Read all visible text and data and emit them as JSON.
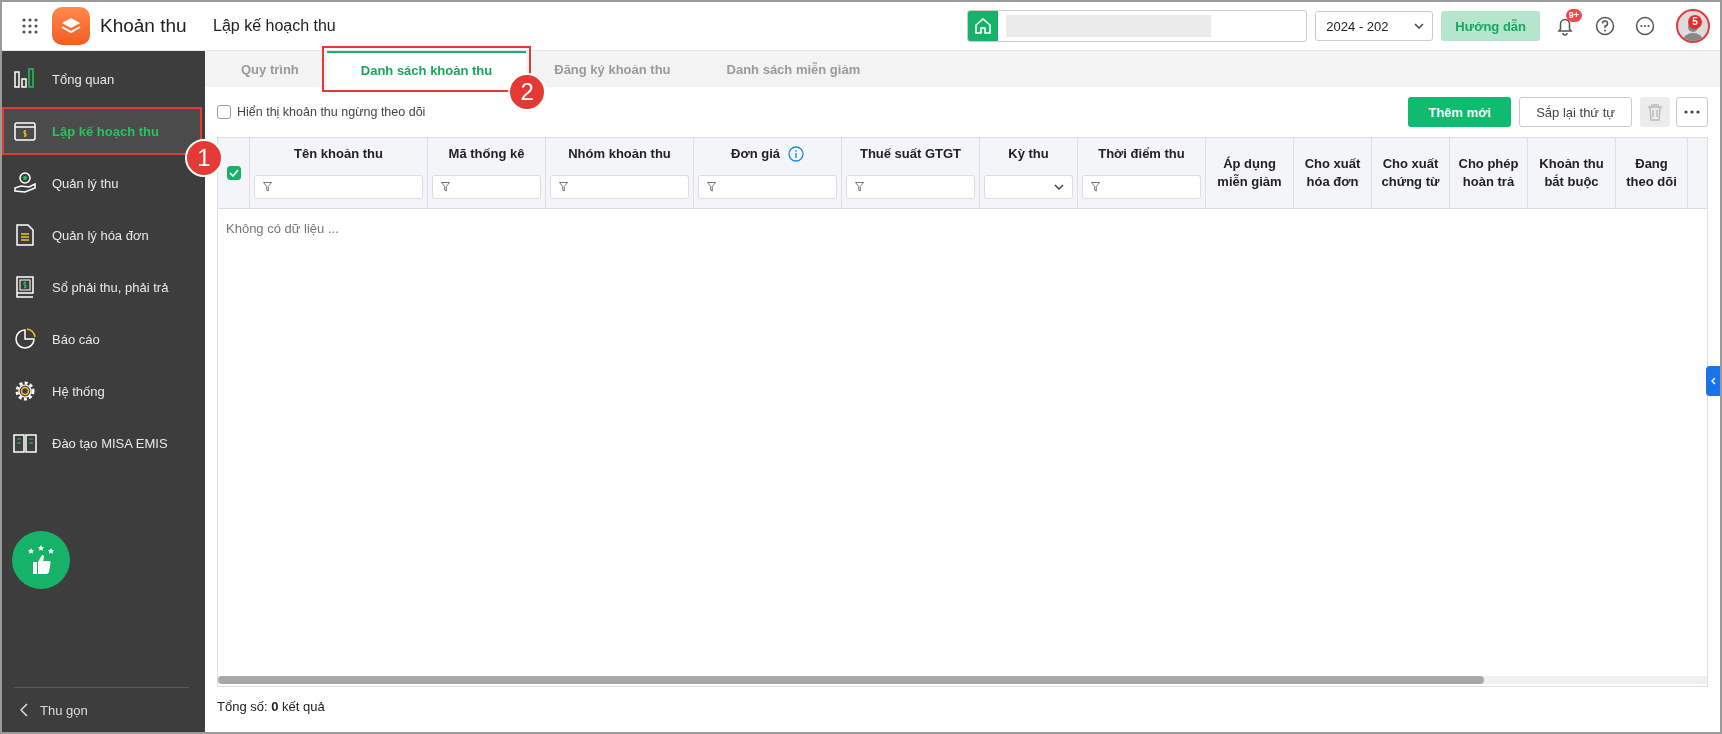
{
  "header": {
    "app_name": "Khoản thu",
    "page_title": "Lập kế hoạch thu",
    "school_year": "2024 - 202",
    "guide_button": "Hướng dẫn",
    "notification_badge": "9+",
    "avatar_badge": "5"
  },
  "sidebar": {
    "items": [
      {
        "label": "Tổng quan",
        "selected": false
      },
      {
        "label": "Lập kế hoạch thu",
        "selected": true,
        "callout": "1"
      },
      {
        "label": "Quản lý thu",
        "selected": false
      },
      {
        "label": "Quản lý hóa đơn",
        "selected": false
      },
      {
        "label": "Sổ phải thu, phải trả",
        "selected": false
      },
      {
        "label": "Báo cáo",
        "selected": false
      },
      {
        "label": "Hệ thống",
        "selected": false
      },
      {
        "label": "Đào tạo MISA EMIS",
        "selected": false
      }
    ],
    "collapse": "Thu gọn"
  },
  "tabs": [
    {
      "label": "Quy trình",
      "selected": false
    },
    {
      "label": "Danh sách khoản thu",
      "selected": true,
      "callout": "2"
    },
    {
      "label": "Đăng ký khoản thu",
      "selected": false
    },
    {
      "label": "Danh sách miễn giảm",
      "selected": false
    }
  ],
  "toolbar": {
    "show_stopped": {
      "label": "Hiển thị khoản thu ngừng theo dõi",
      "checked": false
    },
    "add_button": "Thêm mới",
    "reorder_button": "Sắp lại thứ tự",
    "delete_disabled": true
  },
  "table": {
    "select_all_checked": true,
    "columns": [
      {
        "label": "Tên khoản thu",
        "kind": "text"
      },
      {
        "label": "Mã thống kê",
        "kind": "text"
      },
      {
        "label": "Nhóm khoản thu",
        "kind": "text"
      },
      {
        "label": "Đơn giá",
        "kind": "text",
        "info": true
      },
      {
        "label": "Thuế suất GTGT",
        "kind": "text"
      },
      {
        "label": "Kỳ thu",
        "kind": "select"
      },
      {
        "label": "Thời điểm thu",
        "kind": "text"
      },
      {
        "label": "Áp dụng miễn giảm",
        "kind": "plain"
      },
      {
        "label": "Cho xuất hóa đơn",
        "kind": "plain"
      },
      {
        "label": "Cho xuất chứng từ",
        "kind": "plain"
      },
      {
        "label": "Cho phép hoàn trả",
        "kind": "plain"
      },
      {
        "label": "Khoản thu bắt buộc",
        "kind": "plain"
      },
      {
        "label": "Đang theo dõi",
        "kind": "plain"
      }
    ],
    "empty_text": "Không có dữ liệu ...",
    "total": "Tổng số: **0** kết quả"
  }
}
